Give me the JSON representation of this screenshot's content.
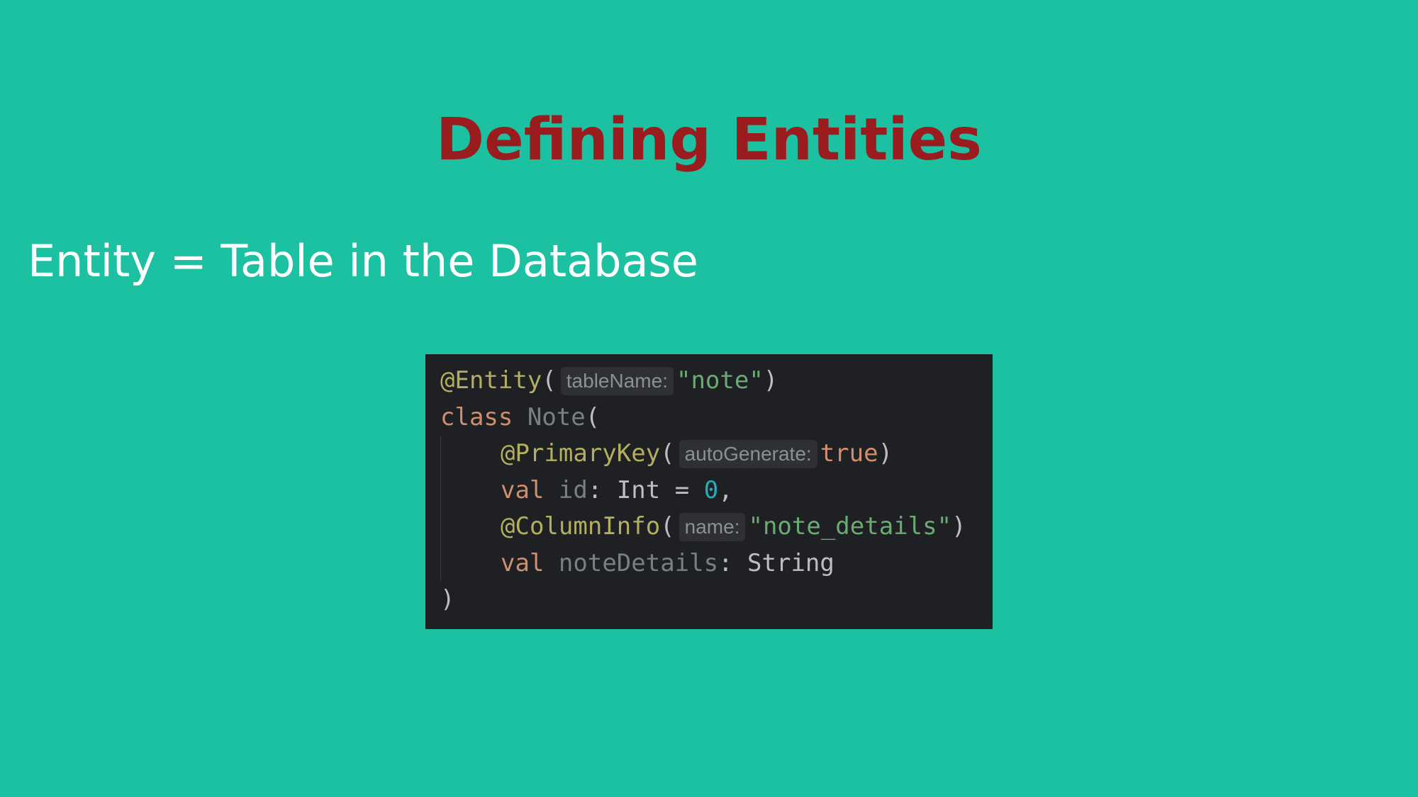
{
  "slide": {
    "title": "Defining Entities",
    "subtitle": "Entity = Table in the Database"
  },
  "code": {
    "line1": {
      "annotation": "@Entity",
      "open": "(",
      "hint": "tableName:",
      "value": "\"note\"",
      "close": ")"
    },
    "line2": {
      "keyword": "class",
      "name": "Note",
      "open": "("
    },
    "line3": {
      "annotation": "@PrimaryKey",
      "open": "(",
      "hint": "autoGenerate:",
      "value": "true",
      "close": ")"
    },
    "line4": {
      "keyword": "val",
      "name": "id",
      "colon": ":",
      "type": "Int",
      "equals": "=",
      "value": "0",
      "comma": ","
    },
    "line5": {
      "annotation": "@ColumnInfo",
      "open": "(",
      "hint": "name:",
      "value": "\"note_details\"",
      "close": ")"
    },
    "line6": {
      "keyword": "val",
      "name": "noteDetails",
      "colon": ":",
      "type": "String"
    },
    "line7": {
      "close": ")"
    }
  },
  "colors": {
    "background": "#1bc1a1",
    "title": "#9b1c1f",
    "subtitle": "#ffffff",
    "code_background": "#1f2023",
    "annotation": "#b3ae60",
    "keyword": "#cf8e6d",
    "string": "#6aab73",
    "number": "#2aacb8"
  }
}
